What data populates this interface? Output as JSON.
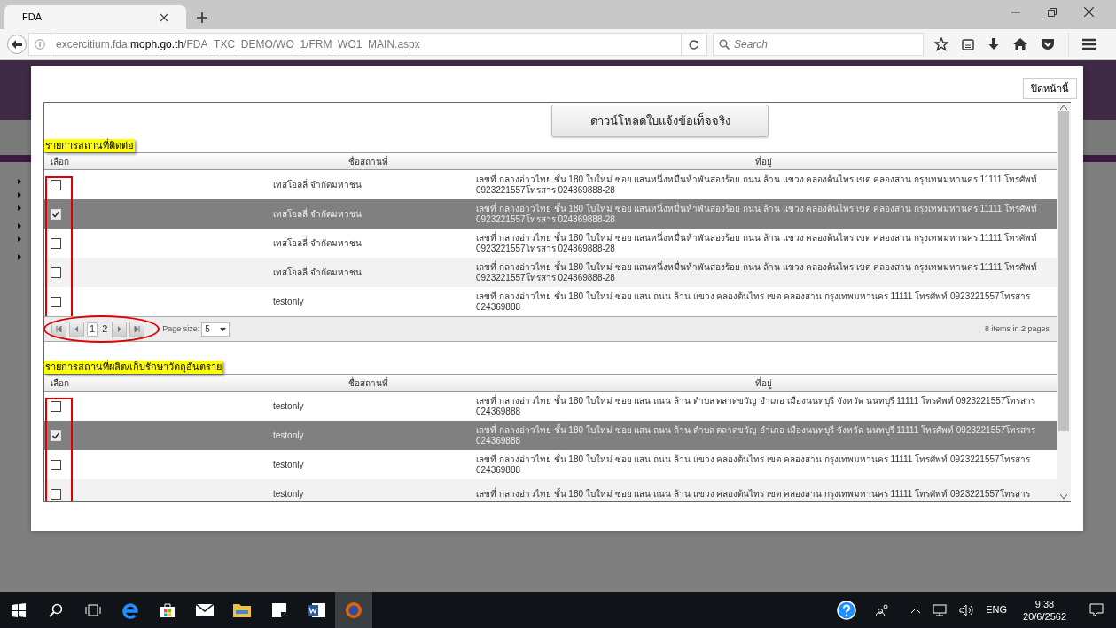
{
  "browser": {
    "tab_title": "FDA",
    "url_prefix": "excercitium.fda.",
    "url_domain": "moph.go.th",
    "url_path": "/FDA_TXC_DEMO/WO_1/FRM_WO1_MAIN.aspx",
    "search_placeholder": "Search"
  },
  "dialog": {
    "close_button": "ปิดหน้านี้",
    "download_button": "ดาวน์โหลดใบแจ้งข้อเท็จจริง",
    "sections": [
      {
        "title": "รายการสถานที่ติดต่อ",
        "columns": [
          "เลือก",
          "ชื่อสถานที่",
          "ที่อยู่"
        ],
        "rows": [
          {
            "checked": false,
            "selected": false,
            "name": "เทสโอลลี่ จำกัดมหาชน",
            "address": "เลขที่ กลางอ่าวไทย ชั้น 180 ใบใหม่ ซอย แสนหนึ่งหมื่นห้าพันสองร้อย ถนน ล้าน แขวง คลองต้นไทร เขต คลองสาน กรุงเทพมหานคร 11111 โทรศัพท์ 0923221557โทรสาร 024369888-28"
          },
          {
            "checked": true,
            "selected": true,
            "name": "เทสโอลลี่ จำกัดมหาชน",
            "address": "เลขที่ กลางอ่าวไทย ชั้น 180 ใบใหม่ ซอย แสนหนึ่งหมื่นห้าพันสองร้อย ถนน ล้าน แขวง คลองต้นไทร เขต คลองสาน กรุงเทพมหานคร 11111 โทรศัพท์ 0923221557โทรสาร 024369888-28"
          },
          {
            "checked": false,
            "selected": false,
            "name": "เทสโอลลี่ จำกัดมหาชน",
            "address": "เลขที่ กลางอ่าวไทย ชั้น 180 ใบใหม่ ซอย แสนหนึ่งหมื่นห้าพันสองร้อย ถนน ล้าน แขวง คลองต้นไทร เขต คลองสาน กรุงเทพมหานคร 11111 โทรศัพท์ 0923221557โทรสาร 024369888-28"
          },
          {
            "checked": false,
            "selected": false,
            "name": "เทสโอลลี่ จำกัดมหาชน",
            "address": "เลขที่ กลางอ่าวไทย ชั้น 180 ใบใหม่ ซอย แสนหนึ่งหมื่นห้าพันสองร้อย ถนน ล้าน แขวง คลองต้นไทร เขต คลองสาน กรุงเทพมหานคร 11111 โทรศัพท์ 0923221557โทรสาร 024369888-28"
          },
          {
            "checked": false,
            "selected": false,
            "name": "testonly",
            "address": "เลขที่ กลางอ่าวไทย ชั้น 180 ใบใหม่ ซอย แสน ถนน ล้าน แขวง คลองต้นไทร เขต คลองสาน กรุงเทพมหานคร 11111 โทรศัพท์ 0923221557โทรสาร 024369888"
          }
        ],
        "pager": {
          "pages": [
            {
              "label": "1",
              "selected": true
            },
            {
              "label": "2",
              "selected": false
            }
          ],
          "page_size_label": "Page size:",
          "page_size": "5",
          "summary": "8 items in 2 pages"
        }
      },
      {
        "title": "รายการสถานที่ผลิต/เก็บรักษาวัตถุอันตราย",
        "columns": [
          "เลือก",
          "ชื่อสถานที่",
          "ที่อยู่"
        ],
        "rows": [
          {
            "checked": false,
            "selected": false,
            "name": "testonly",
            "address": "เลขที่ กลางอ่าวไทย ชั้น 180 ใบใหม่ ซอย แสน ถนน ล้าน ตำบล ตลาดขวัญ อำเภอ เมืองนนทบุรี จังหวัด นนทบุรี 11111 โทรศัพท์ 0923221557โทรสาร 024369888"
          },
          {
            "checked": true,
            "selected": true,
            "name": "testonly",
            "address": "เลขที่ กลางอ่าวไทย ชั้น 180 ใบใหม่ ซอย แสน ถนน ล้าน ตำบล ตลาดขวัญ อำเภอ เมืองนนทบุรี จังหวัด นนทบุรี 11111 โทรศัพท์ 0923221557โทรสาร 024369888"
          },
          {
            "checked": false,
            "selected": false,
            "name": "testonly",
            "address": "เลขที่ กลางอ่าวไทย ชั้น 180 ใบใหม่ ซอย แสน ถนน ล้าน แขวง คลองต้นไทร เขต คลองสาน กรุงเทพมหานคร 11111 โทรศัพท์ 0923221557โทรสาร 024369888"
          },
          {
            "checked": false,
            "selected": false,
            "name": "testonly",
            "address": "เลขที่ กลางอ่าวไทย ชั้น 180 ใบใหม่ ซอย แสน ถนน ล้าน แขวง คลองต้นไทร เขต คลองสาน กรุงเทพมหานคร 11111 โทรศัพท์ 0923221557โทรสาร"
          }
        ]
      }
    ]
  },
  "taskbar": {
    "language": "ENG",
    "time": "9:38",
    "date": "20/6/2562"
  }
}
